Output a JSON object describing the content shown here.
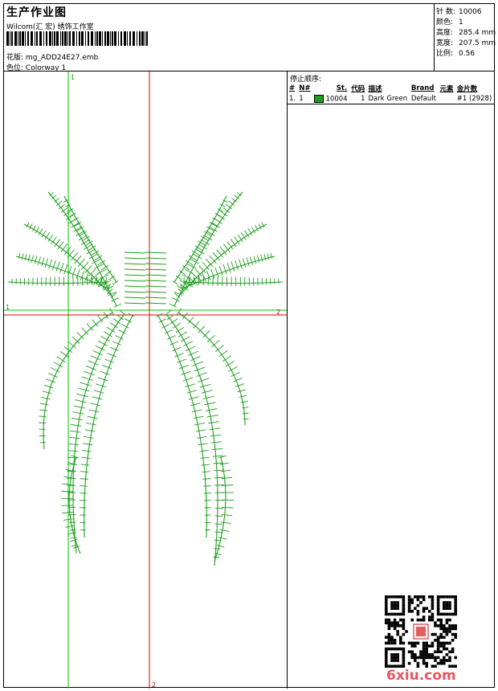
{
  "header": {
    "title": "生产作业图",
    "company": "Wilcom(汇 宏) 绣饰工作室",
    "file_label": "花版:",
    "file_name": "mg_ADD24E27.emb",
    "colorway_label": "色位:",
    "colorway_name": "Colorway 1"
  },
  "info": [
    {
      "label": "针 数:",
      "value": "10006"
    },
    {
      "label": "颜色:",
      "value": "1"
    },
    {
      "label": "高度:",
      "value": "285.4 mm"
    },
    {
      "label": "宽度:",
      "value": "207.5 mm"
    },
    {
      "label": "比例:",
      "value": "0.56"
    }
  ],
  "stop_sequence": {
    "title": "停止顺序:",
    "columns": [
      "#",
      "N#",
      "St.",
      "代码",
      "描述",
      "Brand",
      "元素",
      "金片数"
    ],
    "rows": [
      {
        "index": "1.",
        "n": "1",
        "swatch": "#1e9e1e",
        "code": "10004",
        "st": "1",
        "desc": "Dark Green",
        "brand": "Default",
        "sequins": "#1 (2928)"
      }
    ]
  },
  "axis": {
    "v1": "1",
    "v2": "2",
    "h1": "1",
    "h2": "2"
  },
  "colors": {
    "thread": "#1e9e1e",
    "axis_green": "#00c800",
    "axis_red": "#e00000",
    "watermark": "#e8555f"
  },
  "watermark": "6xiu.com"
}
